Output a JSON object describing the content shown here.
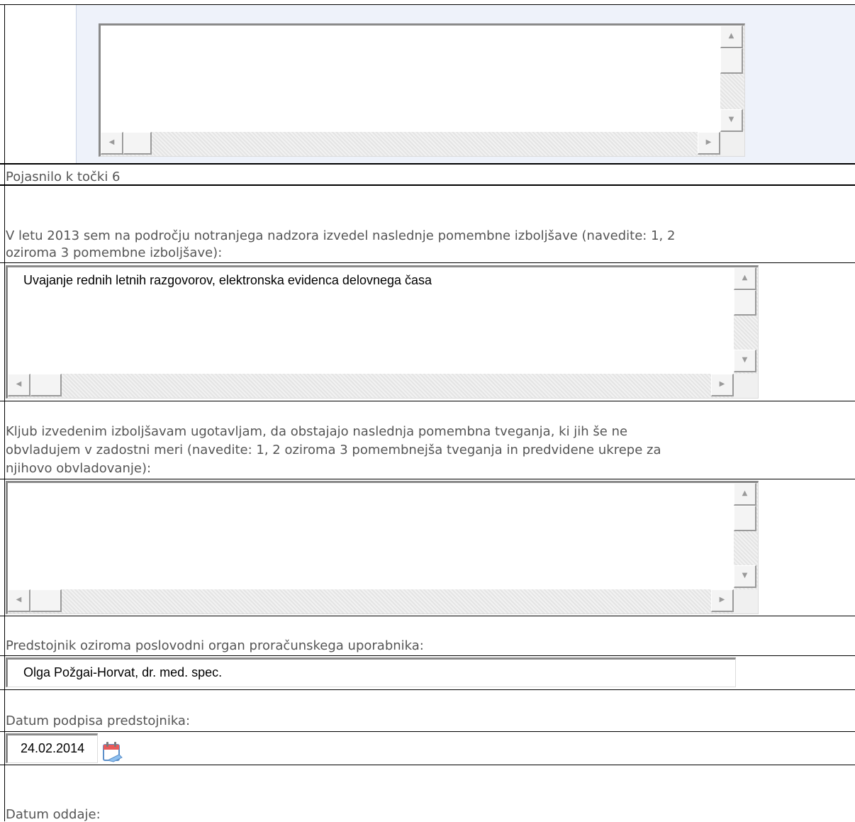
{
  "section6_note_label": "Pojasnilo k točki 6",
  "improvements": {
    "label_line1": "V letu 2013 sem na področju notranjega nadzora izvedel naslednje pomembne izboljšave (navedite: 1, 2",
    "label_line2": "oziroma 3 pomembne izboljšave):",
    "value": "Uvajanje rednih letnih razgovorov,  elektronska evidenca delovnega časa"
  },
  "risks": {
    "label_line1": "Kljub izvedenim izboljšavam ugotavljam, da obstajajo naslednja pomembna tveganja, ki jih še ne",
    "label_line2": "obvladujem v zadostni meri (navedite: 1, 2 oziroma 3 pomembnejša tveganja in predvidene ukrepe za",
    "label_line3": "njihovo obvladovanje):",
    "value": ""
  },
  "head": {
    "label": "Predstojnik oziroma poslovodni organ proračunskega uporabnika:",
    "value": "Olga Požgai-Horvat, dr. med. spec."
  },
  "signature_date": {
    "label": "Datum podpisa predstojnika:",
    "value": "24.02.2014"
  },
  "submission_date": {
    "label": "Datum oddaje:"
  },
  "icons": {
    "calendar": "calendar-icon",
    "up": "▲",
    "down": "▼",
    "left": "◀",
    "right": "▶"
  }
}
